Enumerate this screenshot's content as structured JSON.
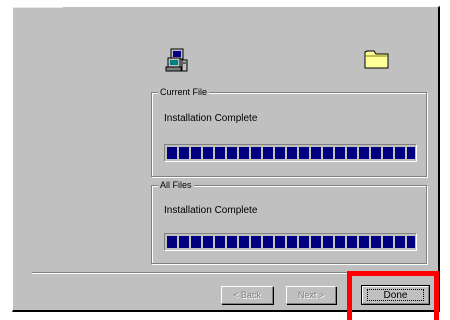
{
  "icons": {
    "setup": "setup-computer-icon",
    "folder": "folder-icon"
  },
  "current_file": {
    "legend": "Current File",
    "status": "Installation Complete",
    "progress": 1.0
  },
  "all_files": {
    "legend": "All Files",
    "status": "Installation Complete",
    "progress": 1.0
  },
  "buttons": {
    "back_label": "< Back",
    "next_label": "Next >",
    "done_label": "Done"
  },
  "colors": {
    "progress_fill": "#000080",
    "window_bg": "#c0c0c0",
    "highlight": "#ff0000"
  }
}
